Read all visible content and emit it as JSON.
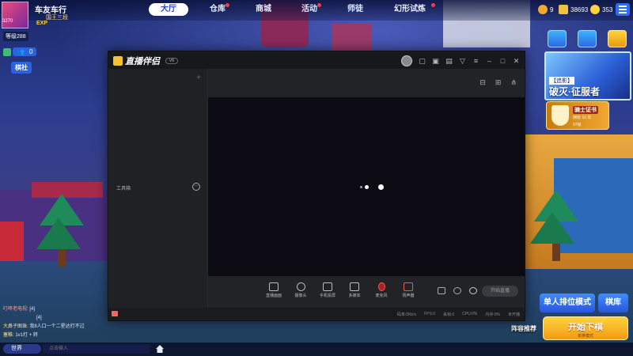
{
  "nav": {
    "tabs": [
      {
        "label": "大厅",
        "active": true,
        "dot": false
      },
      {
        "label": "仓库",
        "active": false,
        "dot": true
      },
      {
        "label": "商城",
        "active": false,
        "dot": false
      },
      {
        "label": "活动",
        "active": false,
        "dot": true
      },
      {
        "label": "师徒",
        "active": false,
        "dot": false
      },
      {
        "label": "幻形试炼",
        "active": false,
        "dot": true
      }
    ]
  },
  "currency": {
    "coins": "9",
    "tickets": "38693",
    "gems": "353"
  },
  "player": {
    "name": "车友车行",
    "rank": "国王三段",
    "exp_label": "EXP",
    "id": "3270",
    "level_label": "等级288",
    "friends_count": "0",
    "guild_label": "棋社"
  },
  "event_banner": {
    "tag": "【追影】",
    "title": "破灭·征服者"
  },
  "certificate": {
    "title": "骑士证书",
    "line1": "拥有 10 年",
    "line2": "97级"
  },
  "actions": {
    "mode_label": "单人排位模式",
    "chess_label": "棋库",
    "lineup_label": "阵容推荐",
    "start_label": "开始下棋",
    "start_sub": "单排模式"
  },
  "chat": {
    "lines": [
      {
        "name": "叮咚老电视:",
        "text": "[4]"
      },
      {
        "name": "",
        "text": "[4]"
      },
      {
        "name": "大鼻子图珠:",
        "text": "我8人口一个二星达打不过"
      },
      {
        "name": "塞稚:",
        "text": "1v1打 + 转"
      }
    ],
    "channel": "世界",
    "input_placeholder": "点击输入"
  },
  "stream_app": {
    "title": "直播伴侣",
    "badge": "v6",
    "toolbox_label": "工具箱",
    "tools": [
      {
        "label": "直播画面",
        "icon": "screen-icon"
      },
      {
        "label": "摄像头",
        "icon": "camera-icon"
      },
      {
        "label": "手机投屏",
        "icon": "phone-cast-icon"
      },
      {
        "label": "多媒体",
        "icon": "media-icon"
      },
      {
        "label": "麦克风",
        "icon": "microphone-icon"
      },
      {
        "label": "扬声器",
        "icon": "speaker-icon"
      }
    ],
    "go_live_label": "开始直播",
    "stats": [
      "码率:0Kb/s",
      "FPS:0",
      "丢帧:0",
      "CPU:0%",
      "内存:0%",
      "未开播"
    ]
  },
  "colors": {
    "accent": "#2a63e0",
    "start_button": "#f29a12",
    "app_bg": "#222326",
    "preview_bg": "#0c0b14"
  }
}
